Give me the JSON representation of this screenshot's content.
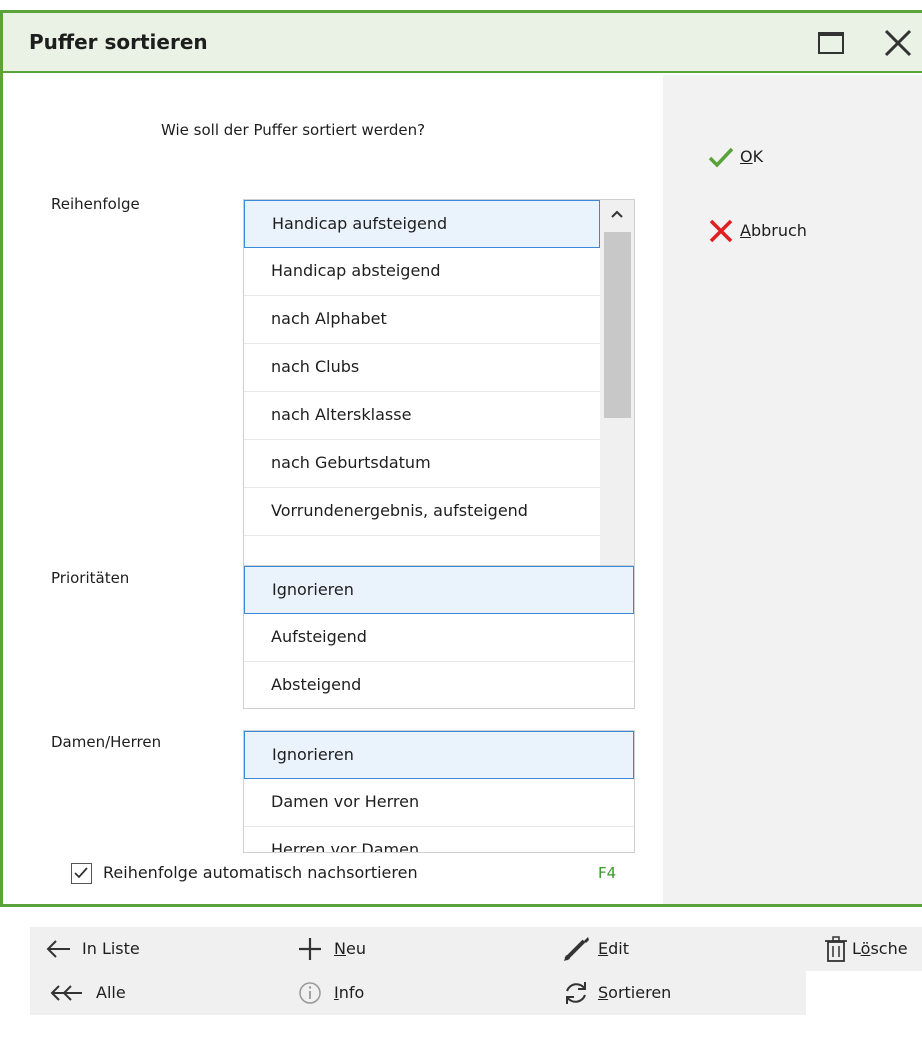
{
  "dialog": {
    "title": "Puffer sortieren",
    "question": "Wie soll der Puffer sortiert werden?"
  },
  "order": {
    "label": "Reihenfolge",
    "items": [
      "Handicap aufsteigend",
      "Handicap absteigend",
      "nach Alphabet",
      "nach Clubs",
      "nach Altersklasse",
      "nach Geburtsdatum",
      "Vorrundenergebnis, aufsteigend"
    ],
    "selected": "Handicap aufsteigend"
  },
  "priorities": {
    "label": "Prioritäten",
    "items": [
      "Ignorieren",
      "Aufsteigend",
      "Absteigend"
    ],
    "selected": "Ignorieren"
  },
  "gender": {
    "label": "Damen/Herren",
    "items": [
      "Ignorieren",
      "Damen vor Herren",
      "Herren vor Damen"
    ],
    "selected": "Ignorieren"
  },
  "auto_sort": {
    "label": "Reihenfolge automatisch nachsortieren",
    "checked": true,
    "shortcut": "F4"
  },
  "actions": {
    "ok_underline": "O",
    "ok_rest": "K",
    "cancel_underline": "A",
    "cancel_rest": "bbruch"
  },
  "toolbar": {
    "in_liste": "In Liste",
    "neu_u": "N",
    "neu_rest": "eu",
    "edit_u": "E",
    "edit_rest": "dit",
    "loeschen_pre": "L",
    "loeschen_u": "ö",
    "loeschen_rest": "sche",
    "alle": "Alle",
    "info_u": "I",
    "info_rest": "nfo",
    "sortieren_u": "S",
    "sortieren_rest": "ortieren"
  },
  "colors": {
    "accent_green": "#5aa33a",
    "title_bg": "#e9f2e5",
    "selection_border": "#3a88d8",
    "cancel_red": "#e02020",
    "ok_green": "#5aa33a"
  }
}
